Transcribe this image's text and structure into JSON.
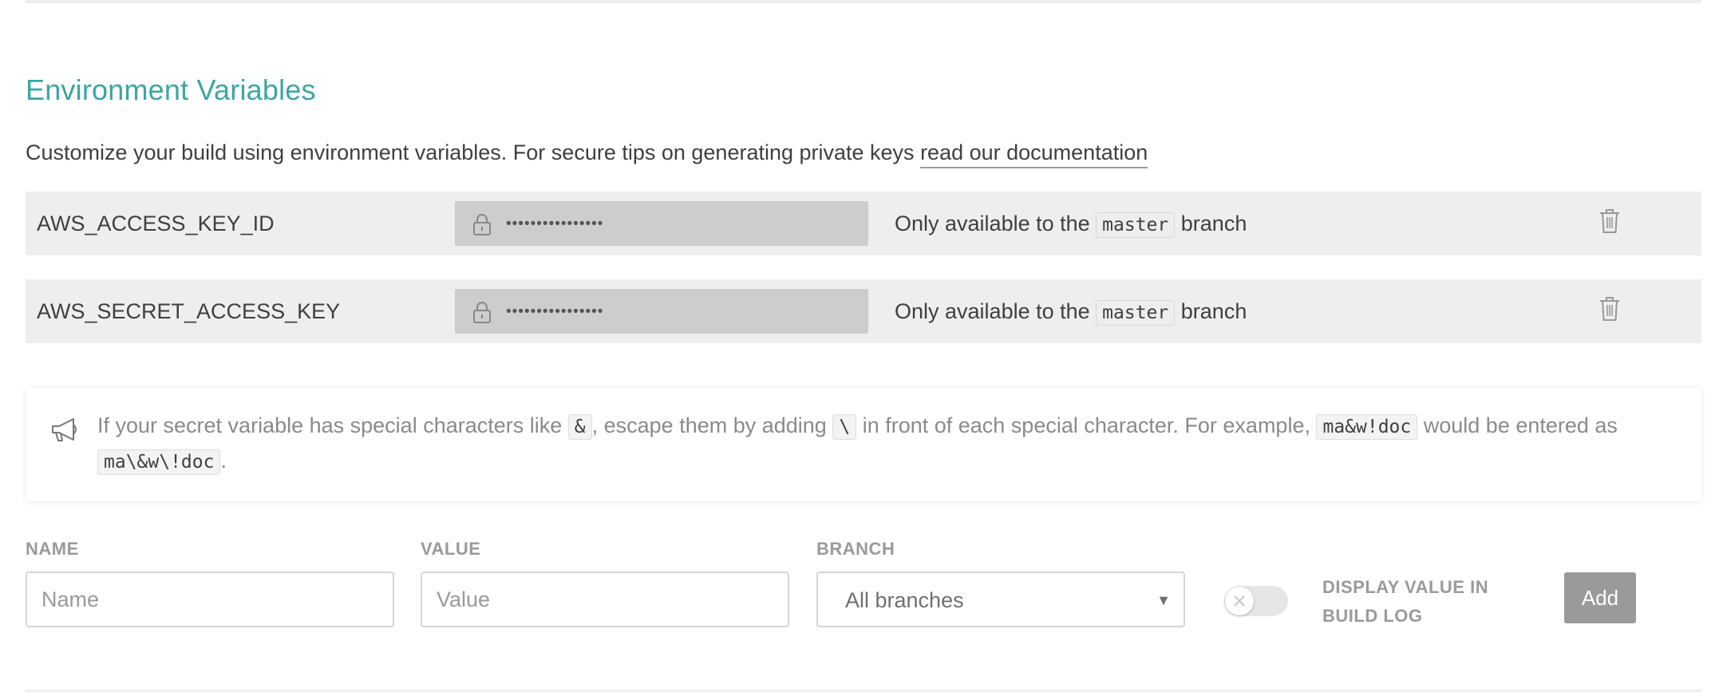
{
  "section": {
    "title": "Environment Variables",
    "intro_text": "Customize your build using environment variables. For secure tips on generating private keys ",
    "intro_link": "read our documentation"
  },
  "env_vars": [
    {
      "name": "AWS_ACCESS_KEY_ID",
      "masked_value": "••••••••••••••••",
      "branch_prefix": "Only available to the",
      "branch": "master",
      "branch_suffix": "branch",
      "icons": {
        "lock": "lock-icon",
        "delete": "trash-icon"
      }
    },
    {
      "name": "AWS_SECRET_ACCESS_KEY",
      "masked_value": "••••••••••••••••",
      "branch_prefix": "Only available to the",
      "branch": "master",
      "branch_suffix": "branch",
      "icons": {
        "lock": "lock-icon",
        "delete": "trash-icon"
      }
    }
  ],
  "notice": {
    "icon": "megaphone-icon",
    "part1": "If your secret variable has special characters like ",
    "code1": "&",
    "part2": ", escape them by adding ",
    "code2": "\\",
    "part3": " in front of each special character. For example, ",
    "code3": "ma&w!doc",
    "part4": " would be entered as ",
    "code4": "ma\\&w\\!doc",
    "part5": "."
  },
  "form": {
    "name_label": "NAME",
    "name_placeholder": "Name",
    "value_label": "VALUE",
    "value_placeholder": "Value",
    "branch_label": "BRANCH",
    "branch_selected": "All branches",
    "display_toggle_label": "DISPLAY VALUE IN BUILD LOG",
    "display_toggle_on": false,
    "add_label": "Add"
  },
  "colors": {
    "title": "#3ea5a3",
    "row_bg": "#eeeeee",
    "masked_bg": "#cdcdcd",
    "button_bg": "#9a9a9a"
  }
}
